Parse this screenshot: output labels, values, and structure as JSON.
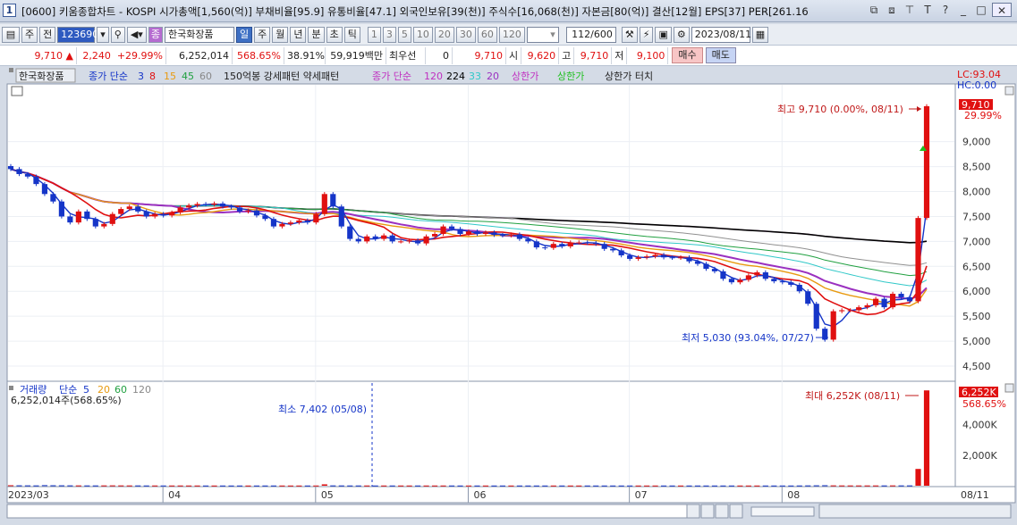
{
  "window": {
    "number": "1",
    "title": "[0600] 키움종합차트 - KOSPI 시가총액[1,560(억)] 부채비율[95.9] 유통비율[47.1] 외국인보유[39(천)] 주식수[16,068(천)] 자본금[80(억)] 결산[12월] EPS[37] PER[261.16"
  },
  "toolbar": {
    "period_type": "주",
    "prev": "전",
    "code": "123690",
    "stock_name": "한국화장품",
    "period_tabs": [
      "일",
      "주",
      "월",
      "년",
      "분",
      "초",
      "틱"
    ],
    "selected_period": "일",
    "intervals": [
      "1",
      "3",
      "5",
      "10",
      "20",
      "30",
      "60",
      "120"
    ],
    "count": "112",
    "count_total": "/600",
    "date": "2023/08/11"
  },
  "quote": {
    "price": "9,710",
    "change": "2,240",
    "change_pct": "+29.99%",
    "volume": "6,252,014",
    "volume_pct": "568.65%",
    "turnover": "38.91%",
    "amount": "59,919백만",
    "pref_label": "최우선",
    "pref_value": "0",
    "close_value": "9,710",
    "open_label": "시",
    "open": "9,620",
    "high_label": "고",
    "high": "9,710",
    "low_label": "저",
    "low": "9,100",
    "buy_label": "매수",
    "sell_label": "매도"
  },
  "legend_price": {
    "name": "한국화장품",
    "ma_label": "종가 단순",
    "ma_periods": [
      "3",
      "8",
      "15",
      "45",
      "60"
    ],
    "extra": "150억봉 강세패턴 약세패턴",
    "ma2_label": "종가 단순",
    "ma2_periods": [
      "120",
      "224",
      "33",
      "20"
    ],
    "upper_limit": "상한가",
    "upper_limit2": "상한가",
    "upper_touch": "상한가 터치"
  },
  "legend_volume": {
    "name": "거래량",
    "ma_label": "단순",
    "ma_periods": [
      "5",
      "20",
      "60",
      "120"
    ],
    "value": "6,252,014주(568.65%)"
  },
  "right_info": {
    "lc": "LC:93.04",
    "hc": "HC:0.00"
  },
  "annotations": {
    "high": "최고 9,710 (0.00%, 08/11)",
    "low": "최저 5,030 (93.04%, 07/27)",
    "vol_max": "최대 6,252K (08/11)",
    "vol_min": "최소 7,402 (05/08)",
    "price_tag": "9,710",
    "price_tag_pct": "29.99%",
    "vol_tag": "6,252K",
    "vol_tag_pct": "568.65%"
  },
  "colors": {
    "up": "#e01010",
    "down": "#1535c8",
    "ma3": "#1535c8",
    "ma8": "#e01010",
    "ma15": "#e89a10",
    "ma45": "#8a3a8a",
    "ma60": "#20a040",
    "ma120": "#c030c0",
    "ma224": "#000000",
    "ma33": "#30c8c8",
    "ma20": "#9a30c0"
  },
  "chart_data": {
    "type": "candlestick",
    "x_labels": [
      "2023/03",
      "04",
      "05",
      "06",
      "07",
      "08",
      "08/11"
    ],
    "y_ticks": [
      "9,000",
      "8,500",
      "8,000",
      "7,500",
      "7,000",
      "6,500",
      "6,000",
      "5,500",
      "5,000",
      "4,500"
    ],
    "y_range": [
      4250,
      10050
    ],
    "volume_ticks": [
      "4,000K",
      "2,000K"
    ],
    "volume_range": [
      0,
      6500
    ],
    "close": [
      8450,
      8350,
      8300,
      8150,
      7950,
      7800,
      7500,
      7380,
      7600,
      7450,
      7300,
      7350,
      7550,
      7650,
      7700,
      7600,
      7500,
      7550,
      7520,
      7580,
      7680,
      7720,
      7750,
      7740,
      7760,
      7700,
      7680,
      7600,
      7620,
      7520,
      7450,
      7300,
      7350,
      7380,
      7420,
      7380,
      7550,
      7950,
      7700,
      7300,
      7050,
      7000,
      7100,
      7050,
      7120,
      7000,
      7000,
      7020,
      6960,
      7100,
      7150,
      7300,
      7250,
      7150,
      7200,
      7150,
      7180,
      7130,
      7120,
      7140,
      7050,
      7000,
      6880,
      6870,
      6950,
      6900,
      6980,
      6980,
      6970,
      6950,
      6850,
      6820,
      6720,
      6650,
      6680,
      6700,
      6730,
      6680,
      6670,
      6680,
      6600,
      6550,
      6450,
      6400,
      6250,
      6180,
      6230,
      6320,
      6380,
      6250,
      6200,
      6180,
      6130,
      6000,
      5750,
      5250,
      5030,
      5600,
      5620,
      5620,
      5680,
      5720,
      5850,
      5680,
      5950,
      5880,
      5800,
      7470,
      9710
    ],
    "volume_k": [
      30,
      25,
      22,
      20,
      35,
      28,
      25,
      22,
      20,
      18,
      18,
      20,
      22,
      20,
      18,
      18,
      16,
      16,
      15,
      15,
      16,
      15,
      15,
      14,
      14,
      14,
      14,
      14,
      14,
      14,
      15,
      15,
      14,
      14,
      14,
      14,
      15,
      90,
      20,
      18,
      16,
      16,
      16,
      15,
      15,
      15,
      15,
      15,
      15,
      15,
      15,
      15,
      15,
      14,
      14,
      14,
      14,
      14,
      14,
      14,
      14,
      14,
      14,
      14,
      14,
      14,
      14,
      14,
      14,
      14,
      14,
      14,
      14,
      14,
      14,
      14,
      14,
      14,
      14,
      14,
      14,
      14,
      14,
      14,
      14,
      14,
      14,
      14,
      14,
      14,
      14,
      14,
      14,
      16,
      20,
      25,
      30,
      22,
      18,
      18,
      18,
      18,
      18,
      18,
      20,
      20,
      20,
      1100,
      6252
    ]
  }
}
